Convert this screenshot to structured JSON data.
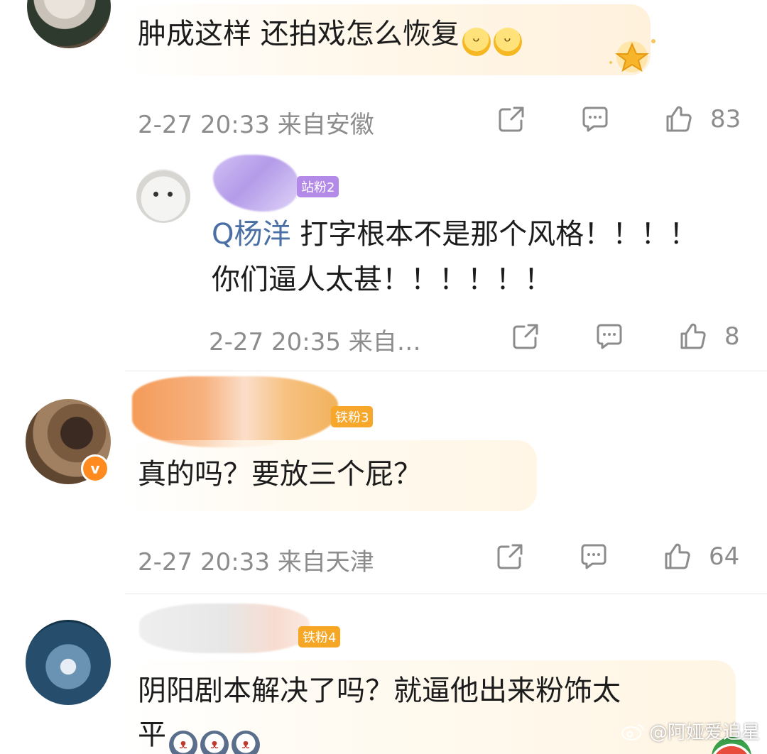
{
  "comments": [
    {
      "text": "肿成这样 还拍戏怎么恢复",
      "time": "2-27 20:33",
      "location": "来自安徽",
      "likes": "83"
    },
    {
      "fan_badge": "站粉2",
      "mention": "Q杨洋",
      "text_line1": " 打字根本不是那个风格！！！！",
      "text_line2": "你们逼人太甚！！！！！！",
      "time": "2-27 20:35",
      "location": "来自…",
      "likes": "8"
    },
    {
      "fan_badge": "铁粉3",
      "text": "真的吗？要放三个屁？",
      "time": "2-27 20:33",
      "location": "来自天津",
      "likes": "64",
      "verified_mark": "v"
    },
    {
      "fan_badge": "铁粉4",
      "text_line1": "阴阳剧本解决了吗？就逼他出来粉饰太",
      "text_line2": "平"
    }
  ],
  "icons": {
    "share": "share-icon",
    "comment": "comment-icon",
    "like": "thumbs-up-icon",
    "emoji_smile": "smile-emoji-icon",
    "emoji_husky": "husky-emoji-icon"
  },
  "watermark": "@阿娅爱追星",
  "colors": {
    "meta_text": "#8c8c8c",
    "mention": "#4a6fa5",
    "fan_purple": "#b38ae8",
    "fan_orange": "#f7a72c",
    "verified": "#ff8a1f"
  }
}
